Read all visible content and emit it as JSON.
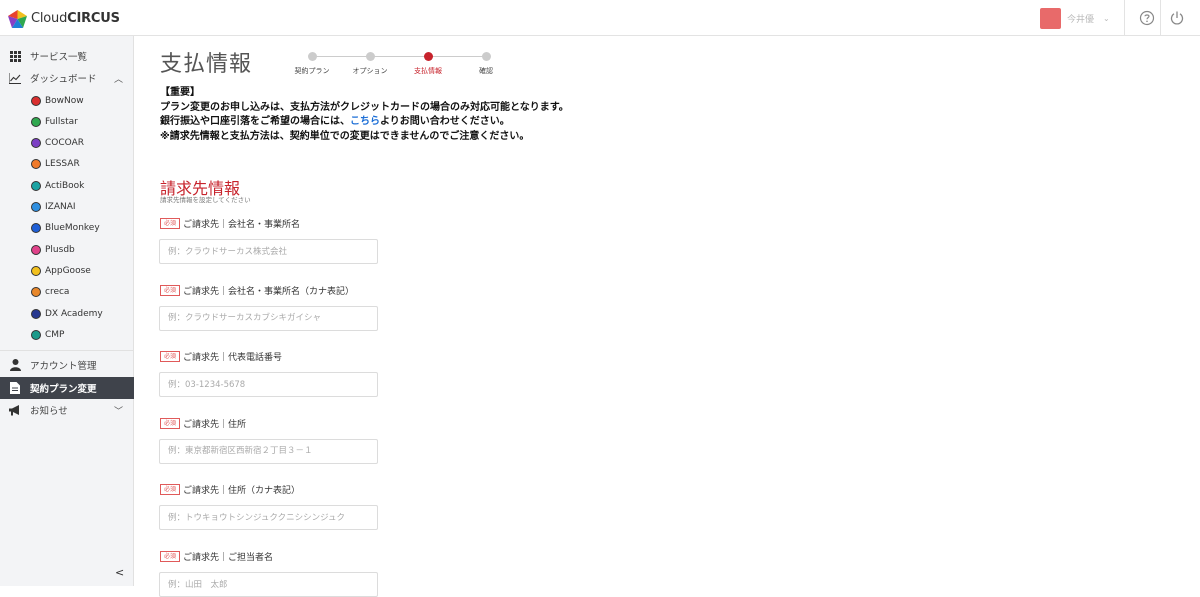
{
  "header": {
    "logo_text_light": "Cloud",
    "logo_text_bold": "CIRCUS",
    "user_name": "今井優",
    "help_icon": "question-circle-icon",
    "power_icon": "power-icon"
  },
  "sidebar": {
    "items": [
      {
        "label": "サービス一覧",
        "icon": "grid-icon"
      },
      {
        "label": "ダッシュボード",
        "icon": "chart-line-icon"
      }
    ],
    "services": [
      {
        "label": "BowNow",
        "color": "#d92f2f"
      },
      {
        "label": "Fullstar",
        "color": "#2fa84f"
      },
      {
        "label": "COCOAR",
        "color": "#7b3fc4"
      },
      {
        "label": "LESSAR",
        "color": "#f07a2a"
      },
      {
        "label": "ActiBook",
        "color": "#1aa3a3"
      },
      {
        "label": "IZANAI",
        "color": "#2f8fe0"
      },
      {
        "label": "BlueMonkey",
        "color": "#1f5fd6"
      },
      {
        "label": "Plusdb",
        "color": "#e0428a"
      },
      {
        "label": "AppGoose",
        "color": "#f2c01e"
      },
      {
        "label": "creca",
        "color": "#e8872a"
      },
      {
        "label": "DX Academy",
        "color": "#26378f"
      },
      {
        "label": "CMP",
        "color": "#1c9a8a"
      }
    ],
    "account": "アカウント管理",
    "contract": "契約プラン変更",
    "news": "お知らせ"
  },
  "main": {
    "title": "支払情報",
    "steps": [
      {
        "label": "契約プラン",
        "state": "done"
      },
      {
        "label": "オプション",
        "state": "done"
      },
      {
        "label": "支払情報",
        "state": "current"
      },
      {
        "label": "確認",
        "state": "todo"
      }
    ],
    "notice": {
      "line1": "【重要】",
      "line2": "プラン変更のお申し込みは、支払方法がクレジットカードの場合のみ対応可能となります。",
      "line3_pre": "銀行振込や口座引落をご希望の場合には、",
      "line3_link": "こちら",
      "line3_post": "よりお問い合わせください。",
      "line4": "※請求先情報と支払方法は、契約単位での変更はできませんのでご注意ください。"
    },
    "section_title": "請求先情報",
    "section_subtitle": "請求先情報を設定してください",
    "required_badge": "必須",
    "fields": [
      {
        "label": "ご請求先｜会社名・事業所名",
        "placeholder": "例：クラウドサーカス株式会社"
      },
      {
        "label": "ご請求先｜会社名・事業所名（カナ表記）",
        "placeholder": "例：クラウドサーカスカブシキガイシャ"
      },
      {
        "label": "ご請求先｜代表電話番号",
        "placeholder": "例：03-1234-5678"
      },
      {
        "label": "ご請求先｜住所",
        "placeholder": "例：東京都新宿区西新宿２丁目３－１"
      },
      {
        "label": "ご請求先｜住所（カナ表記）",
        "placeholder": "例：トウキョウトシンジュククニシシンジュク"
      },
      {
        "label": "ご請求先｜ご担当者名",
        "placeholder": "例：山田　太郎"
      }
    ]
  }
}
